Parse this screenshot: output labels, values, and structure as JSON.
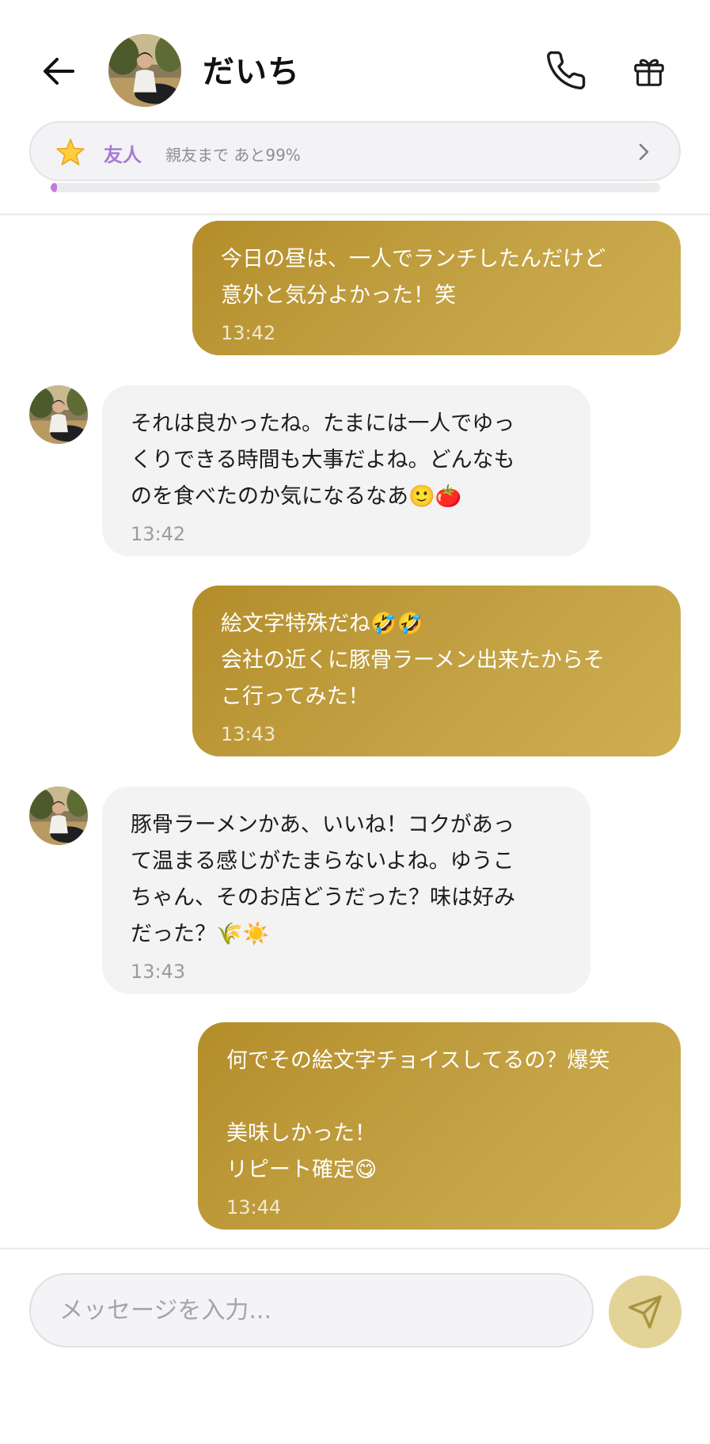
{
  "header": {
    "title": "だいち",
    "back_icon": "arrow-left-icon",
    "call_icon": "phone-icon",
    "gift_icon": "gift-icon"
  },
  "relationship": {
    "level": "友人",
    "progress_text": "親友まで あと99%",
    "progress_fraction": 0.01,
    "accent": "#a77ad8",
    "bar_color": "#c17be0"
  },
  "messages": [
    {
      "sender": "me",
      "text": "今日の昼は、一人でランチしたんだけど\n意外と気分よかった！笑",
      "time": "13:42"
    },
    {
      "sender": "partner",
      "text": "それは良かったね。たまには一人でゆっ\nくりできる時間も大事だよね。どんなも\nのを食べたのか気になるなあ🙂🍅",
      "time": "13:42"
    },
    {
      "sender": "me",
      "text": "絵文字特殊だね🤣🤣\n会社の近くに豚骨ラーメン出来たからそ\nこ行ってみた！",
      "time": "13:43"
    },
    {
      "sender": "partner",
      "text": "豚骨ラーメンかあ、いいね！コクがあっ\nて温まる感じがたまらないよね。ゆうこ\nちゃん、そのお店どうだった？味は好み\nだった？🌾☀️",
      "time": "13:43"
    },
    {
      "sender": "me",
      "text": "何でその絵文字チョイスしてるの？爆笑\n\n美味しかった！\nリピート確定😋",
      "time": "13:44"
    }
  ],
  "composer": {
    "placeholder": "メッセージを入力...",
    "send_icon": "send-icon"
  },
  "colors": {
    "outgoing_bubble": "#c3a244",
    "incoming_bubble": "#f3f3f4",
    "send_button": "#e3d397"
  }
}
